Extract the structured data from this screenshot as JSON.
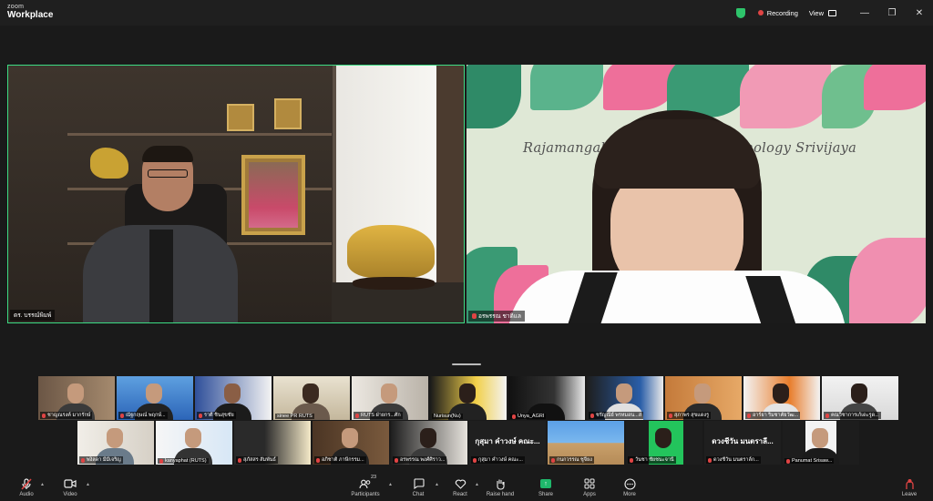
{
  "app": {
    "brand_top": "zoom",
    "brand_main": "Workplace"
  },
  "titlebar": {
    "recording_label": "Recording",
    "view_label": "View",
    "colors": {
      "shield": "#2ec46b",
      "record": "#e04444"
    }
  },
  "main_video": {
    "left_name": "ดร. บรรณ์พิมพ์",
    "right_name": "อรพรรณ ชาติแล",
    "right_banner": "Rajamangala University of Technology Srivijaya",
    "active_speaker_border": "#3ddc84"
  },
  "gallery": {
    "row1": [
      {
        "name": "ชาญณรงค์ มากรักษ์"
      },
      {
        "name": "ณัฐกฤษณ์ พฤกษ์..."
      },
      {
        "name": "ราตี ชินสุขชัย"
      },
      {
        "name": "sinee PR RUTS"
      },
      {
        "name": "RUTS ฝ่ายกร...ศัก"
      },
      {
        "name": "Nurisun(Nu)"
      },
      {
        "name": "Unya_AGRI"
      },
      {
        "name": "ชรัญณีย์ พรหมอน...ส"
      },
      {
        "name": "สุภาพร สุขแดงรู"
      },
      {
        "name": "อาร์ยา ริมชาคัยวัฒ..."
      },
      {
        "name": "คณวิชาการเก้เดะรูด..."
      }
    ],
    "row2": [
      {
        "name": "พงิลดา มีมีเจริญ"
      },
      {
        "name": "kanyaphat (RUTS)"
      },
      {
        "name": "สุภัสสร สัมพันธ์"
      },
      {
        "name": "อภิชาติ ภาษีกรรม..."
      },
      {
        "name": "อรพรรณ พงศ์ศิราว..."
      },
      {
        "name": "กุสุมา คำวงษ์ คณะ...",
        "center": "กุสุมา คำวงษ์ คณะ..."
      },
      {
        "name": "กนกวรรณ ชูจี่ยง"
      },
      {
        "name": "วันชา ชัยชนะจานี"
      },
      {
        "name": "ดวงชีวัน มนตราล์ก...",
        "center": "ดวงชีวัน มนตราลี..."
      },
      {
        "name": "Panumat Srisaw..."
      }
    ]
  },
  "toolbar": {
    "audio": "Audio",
    "video": "Video",
    "participants": "Participants",
    "participants_count": "23",
    "chat": "Chat",
    "react": "React",
    "raise_hand": "Raise hand",
    "share": "Share",
    "apps": "Apps",
    "more": "More",
    "leave": "Leave"
  }
}
